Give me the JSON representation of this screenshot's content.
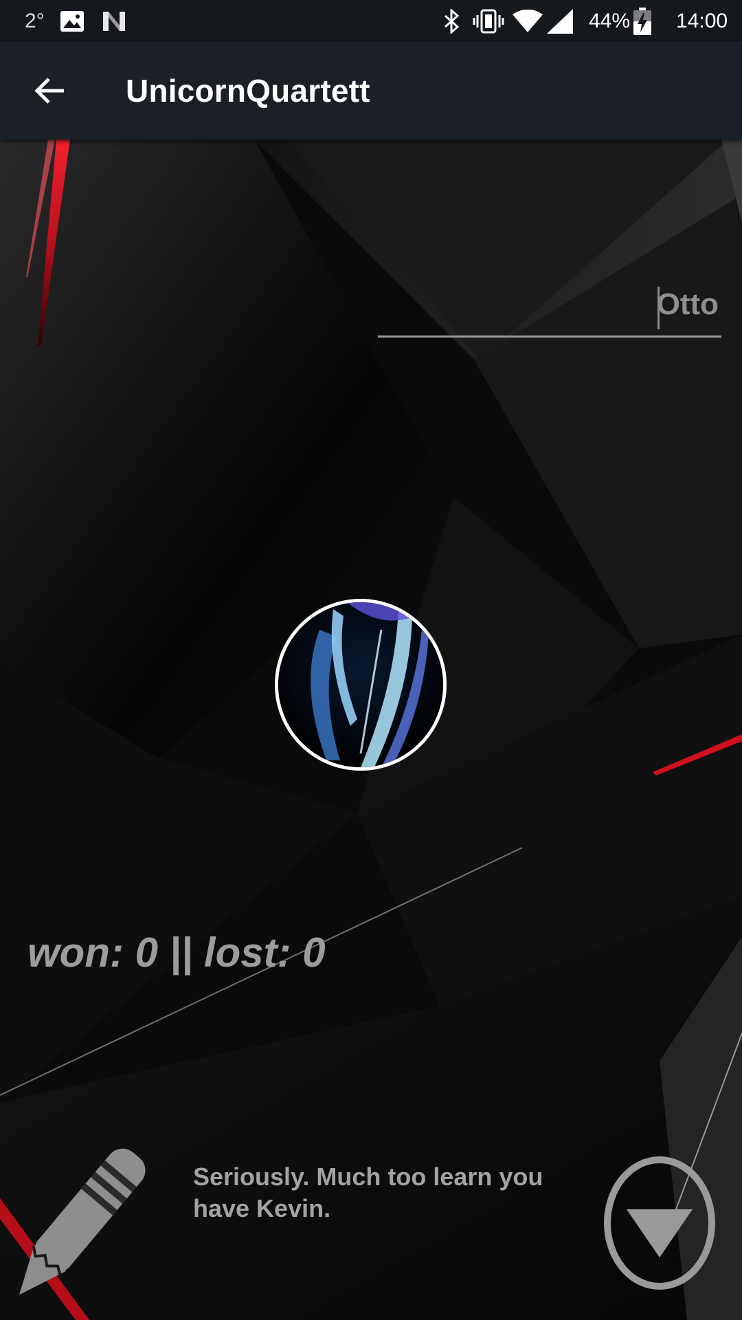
{
  "status_bar": {
    "temperature": "2°",
    "battery_percent": "44%",
    "time": "14:00",
    "icons": [
      "photo-icon",
      "n-notification-icon",
      "bluetooth-icon",
      "vibrate-icon",
      "wifi-icon",
      "signal-icon",
      "battery-charging-icon"
    ]
  },
  "app_bar": {
    "title": "UnicornQuartett",
    "back_icon": "arrow-back-icon"
  },
  "profile": {
    "name_value": "Otto",
    "score_text": "won: 0 || lost: 0",
    "hint_text": "Seriously. Much too learn you have Kevin."
  },
  "icons": {
    "edit": "pencil-icon",
    "next": "triangle-down-circle-icon"
  },
  "colors": {
    "status_bar_bg": "#15181d",
    "app_bar_bg": "#1b1f26",
    "accent_red": "#e0101e",
    "text_gray": "#9c9c9c"
  }
}
